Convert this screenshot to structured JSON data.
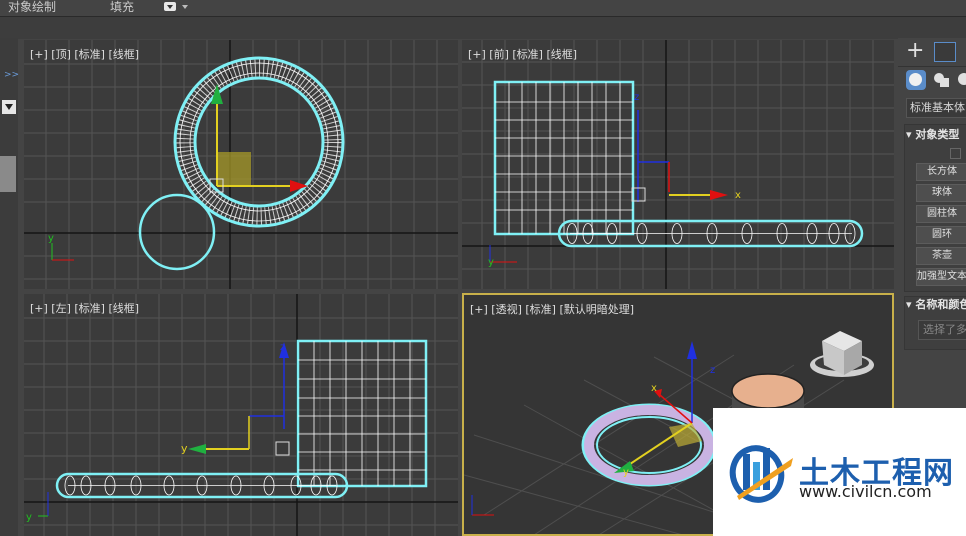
{
  "menu": {
    "object_paint": "对象绘制",
    "fill": "填充"
  },
  "viewports": {
    "top": {
      "label": "[+] [顶] [标准] [线框]"
    },
    "front": {
      "label": "[+] [前] [标准] [线框]"
    },
    "left": {
      "label": "[+] [左] [标准] [线框]"
    },
    "persp": {
      "label": "[+] [透视] [标准] [默认明暗处理]"
    }
  },
  "command_panel": {
    "category": "标准基本体",
    "object_type_title": "对象类型",
    "buttons": [
      "长方体",
      "球体",
      "圆柱体",
      "圆环",
      "茶壶",
      "加强型文本"
    ],
    "name_color_title": "名称和颜色",
    "name_placeholder": "选择了多",
    "icons": {
      "create": "plus-icon",
      "modify": "modify-icon",
      "geometry": "sphere-icon",
      "shapes": "shapes-icon"
    }
  },
  "axes": {
    "x": "x",
    "y": "y",
    "z": "z"
  },
  "watermark": {
    "title": "土木工程网",
    "url": "www.civilcn.com"
  },
  "colors": {
    "selection": "#7ff0f5",
    "gizmo_x": "#e01010",
    "gizmo_y": "#e2d020",
    "gizmo_z": "#2030e0",
    "viewport_bg": "#3b3b3b",
    "active_border": "#c8b04a"
  }
}
